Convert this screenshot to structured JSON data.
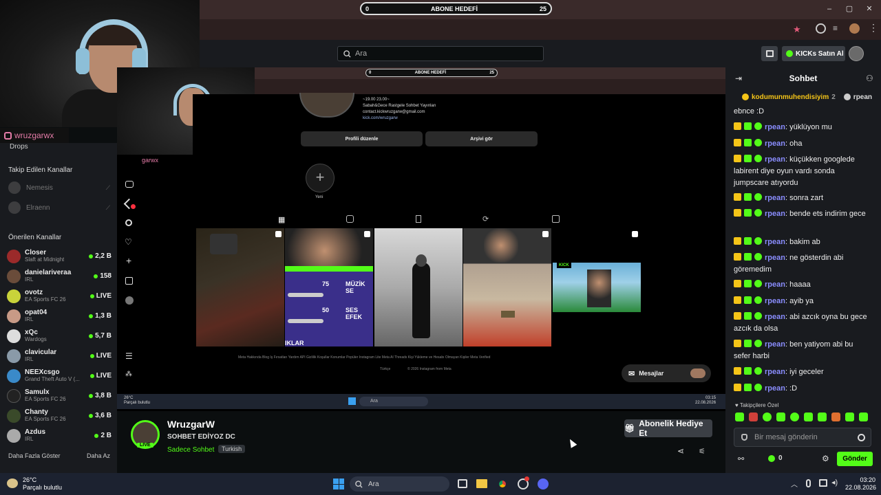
{
  "browser": {
    "goal_label": "ABONE HEDEFİ",
    "goal_min": "0",
    "goal_max": "25"
  },
  "header": {
    "search_placeholder": "Ara",
    "kicks_label": "KICKs Satın Al"
  },
  "overlay": {
    "ig_handle": "wruzgarwx"
  },
  "sidebar": {
    "drops_label": "Drops",
    "followed_title": "Takip Edilen Kanallar",
    "followed": [
      {
        "name": "Nemesis"
      },
      {
        "name": "Elraenn"
      }
    ],
    "recommended_title": "Önerilen Kanallar",
    "channels": [
      {
        "name": "Closer",
        "category": "Slaft at Midnight",
        "viewers": "2,2 B"
      },
      {
        "name": "danielariveraa",
        "category": "IRL",
        "viewers": "158"
      },
      {
        "name": "ovotz",
        "category": "EA Sports FC 26",
        "viewers": "LIVE"
      },
      {
        "name": "opat04",
        "category": "IRL",
        "viewers": "1,3 B"
      },
      {
        "name": "xQc",
        "category": "Wardogs",
        "viewers": "5,7 B"
      },
      {
        "name": "clavicular",
        "category": "IRL",
        "viewers": "LIVE"
      },
      {
        "name": "NEEXcsgo",
        "category": "Grand Theft Auto V (...",
        "viewers": "LIVE"
      },
      {
        "name": "Samulx",
        "category": "EA Sports FC 26",
        "viewers": "3,8 B"
      },
      {
        "name": "Chanty",
        "category": "EA Sports FC 26",
        "viewers": "3,6 B"
      },
      {
        "name": "Azdus",
        "category": "IRL",
        "viewers": "2 B"
      }
    ],
    "show_more": "Daha Fazla Göster",
    "show_less": "Daha Az"
  },
  "instagram": {
    "bio_line1": "~19.00 23.00~",
    "bio_line2": "Sabah&Gece Rastgele Sohbet Yayınları",
    "bio_line3": "contact.kickwruzgarw@gmail.com",
    "bio_link": "kick.com/wruzgarw",
    "edit_profile": "Profili düzenle",
    "archive": "Arşivi gör",
    "new_label": "Yeni",
    "thumb2_num1": "75",
    "thumb2_num2": "50",
    "thumb2_text1": "MÜZİK SE",
    "thumb2_text2": "SES EFEK",
    "thumb2_text3": "IKLAR",
    "kick_tag": "KICK",
    "footer_links": "Meta   Hakkında   Blog   İş Fırsatları   Yardım   API   Gizlilik   Koşullar   Konumlar   Popüler   Instagram Lite   Meta AI   Threads   Kişi Yükleme ve Hesabı Olmayan Kişiler   Meta Verified",
    "footer_lang": "Türkçe",
    "footer_copy": "© 2026 Instagram from Meta",
    "messages": "Mesajlar",
    "weather_temp": "26°C",
    "weather_desc": "Parçalı bulutlu",
    "taskbar_search": "Ara",
    "time": "03:15",
    "date": "22.08.2026"
  },
  "stream_info": {
    "name": "WruzgarW",
    "title": "SOHBET EDİYOZ DC",
    "category": "Sadece Sohbet",
    "tag": "Turkish",
    "live_badge": "LIVE",
    "gift_button": "Abonelik Hediye Et"
  },
  "chat": {
    "title": "Sohbet",
    "pinned_user": "kodumunmuhendisiyim",
    "pinned_count": "2",
    "pinned_user2": "rpean",
    "messages": [
      {
        "user": "",
        "text": "ebnce :D"
      },
      {
        "user": "rpean",
        "text": "yüklüyon mu"
      },
      {
        "user": "rpean",
        "text": "oha"
      },
      {
        "user": "rpean",
        "text": "küçükken googlede labirent diye oyun vardı sonda jumpscare atıyordu"
      },
      {
        "user": "rpean",
        "text": "sonra zart"
      },
      {
        "user": "rpean",
        "text": "bende ets indirim gece"
      },
      {
        "user": "rpean",
        "text": "bakim ab"
      },
      {
        "user": "rpean",
        "text": "ne gösterdin abi göremedim"
      },
      {
        "user": "rpean",
        "text": "haaaa"
      },
      {
        "user": "rpean",
        "text": "ayib ya"
      },
      {
        "user": "rpean",
        "text": "abi azcık oyna bu gece azcık da olsa"
      },
      {
        "user": "rpean",
        "text": "ben yatiyom abi bu sefer harbi"
      },
      {
        "user": "rpean",
        "text": "iyi geceler"
      },
      {
        "user": "rpean",
        "text": ":D"
      }
    ],
    "emote_label": "Takipçilere Özel",
    "input_placeholder": "Bir mesaj gönderin",
    "kicks_count": "0",
    "send_button": "Gönder"
  },
  "taskbar": {
    "weather_temp": "26°C",
    "weather_desc": "Parçalı bulutlu",
    "search": "Ara",
    "time": "03:20",
    "date": "22.08.2026"
  },
  "colors": {
    "kick_green": "#53fc18",
    "chat_username": "#8a8dff",
    "badge_gold": "#f5c518"
  }
}
